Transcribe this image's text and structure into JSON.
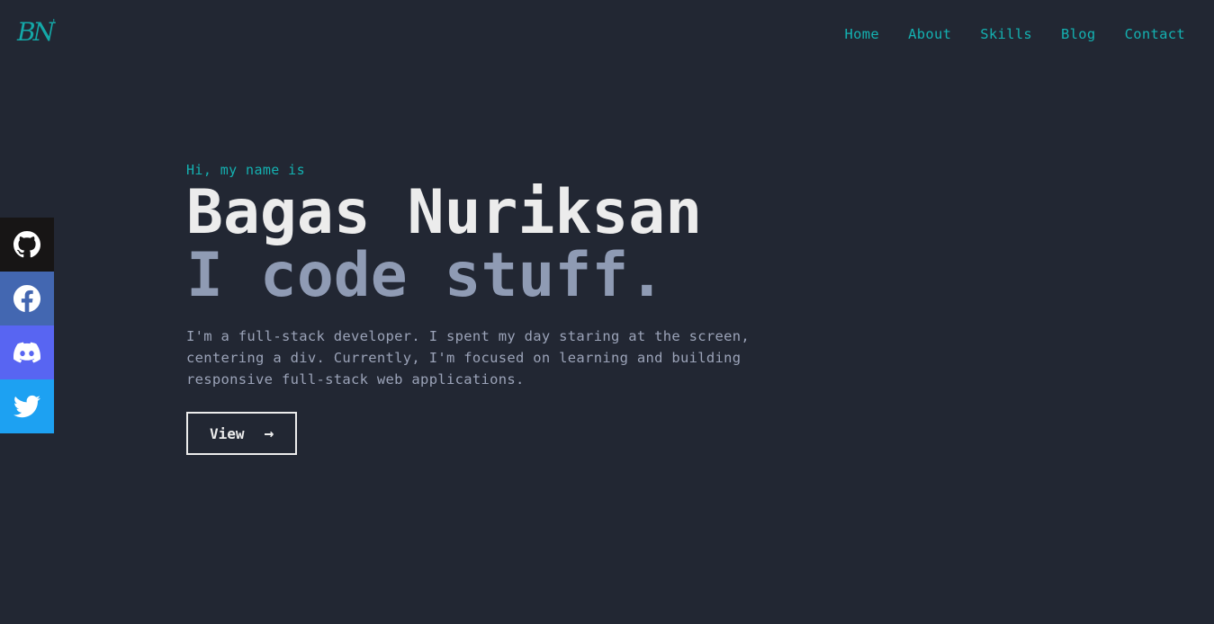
{
  "logo": {
    "text": "BN",
    "accent": "'"
  },
  "nav": {
    "items": [
      "Home",
      "About",
      "Skills",
      "Blog",
      "Contact"
    ]
  },
  "social": [
    {
      "name": "github",
      "icon": "github-icon",
      "color": "#171515"
    },
    {
      "name": "facebook",
      "icon": "facebook-icon",
      "color": "#4367b1"
    },
    {
      "name": "discord",
      "icon": "discord-icon",
      "color": "#5865f2"
    },
    {
      "name": "twitter",
      "icon": "twitter-icon",
      "color": "#1da1f2"
    }
  ],
  "hero": {
    "greeting": "Hi, my name is",
    "name": "Bagas Nuriksan",
    "tagline": "I code stuff.",
    "description": "I'm a full-stack developer. I spent my day staring at the screen, centering a div. Currently, I'm focused on learning and building responsive full-stack web applications.",
    "button_label": "View",
    "button_arrow": "→"
  },
  "colors": {
    "background": "#222733",
    "accent": "#14b1b1",
    "heading": "#ececec",
    "subheading": "#8f9bb4"
  }
}
